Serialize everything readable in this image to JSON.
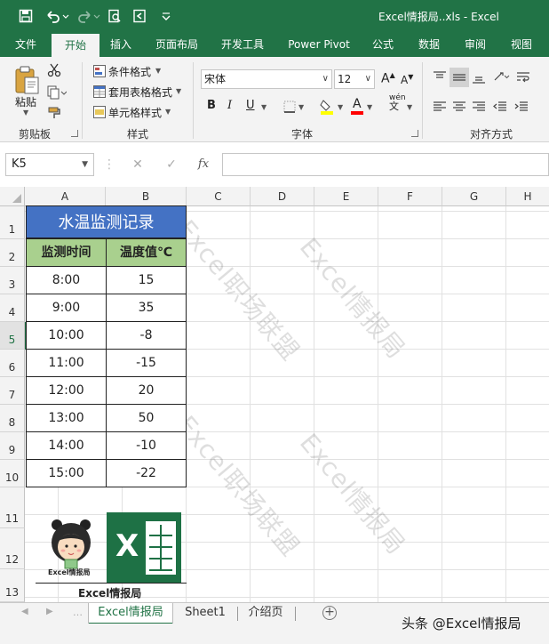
{
  "window": {
    "title": "Excel情报局..xls - Excel"
  },
  "tabs": [
    "文件",
    "开始",
    "插入",
    "页面布局",
    "开发工具",
    "Power Pivot",
    "公式",
    "数据",
    "审阅",
    "视图"
  ],
  "ribbon": {
    "clipboard": {
      "paste_label": "粘贴",
      "group_label": "剪贴板"
    },
    "styles": {
      "conditional_format": "条件格式",
      "table_format": "套用表格格式",
      "cell_styles": "单元格样式",
      "group_label": "样式"
    },
    "font": {
      "name": "宋体",
      "size": "12",
      "bold": "B",
      "italic": "I",
      "underline": "U",
      "grow": "A",
      "shrink": "A",
      "pinyin_top": "wén",
      "pinyin_bottom": "文",
      "font_color_letter": "A",
      "group_label": "字体"
    },
    "alignment": {
      "group_label": "对齐方式"
    }
  },
  "formula_bar": {
    "name_box": "K5",
    "fx_label": "fx",
    "formula": ""
  },
  "grid": {
    "columns": [
      "A",
      "B",
      "C",
      "D",
      "E",
      "F",
      "G",
      "H"
    ],
    "rows": [
      "1",
      "2",
      "3",
      "4",
      "5",
      "6",
      "7",
      "8",
      "9",
      "10",
      "11",
      "12",
      "13"
    ],
    "selected_row": "5"
  },
  "table": {
    "title": "水温监测记录",
    "headers": [
      "监测时间",
      "温度值℃"
    ],
    "rows": [
      [
        "8:00",
        "15"
      ],
      [
        "9:00",
        "35"
      ],
      [
        "10:00",
        "-8"
      ],
      [
        "11:00",
        "-15"
      ],
      [
        "12:00",
        "20"
      ],
      [
        "13:00",
        "50"
      ],
      [
        "14:00",
        "-10"
      ],
      [
        "15:00",
        "-22"
      ]
    ]
  },
  "logo": {
    "mascot_caption": "Excel情报局",
    "bottom_caption": "Excel情报局",
    "excel_letter": "X"
  },
  "watermarks": [
    "Excel职场联盟",
    "Excel情报局",
    "Excel职场联盟",
    "Excel情报局"
  ],
  "sheet_tabs": [
    "Excel情报局",
    "Sheet1",
    "介绍页"
  ],
  "active_sheet": "Excel情报局",
  "credit": "头条 @Excel情报局",
  "colors": {
    "excel_green": "#217346",
    "title_fill": "#4472c4",
    "header_fill": "#a9d08e"
  }
}
